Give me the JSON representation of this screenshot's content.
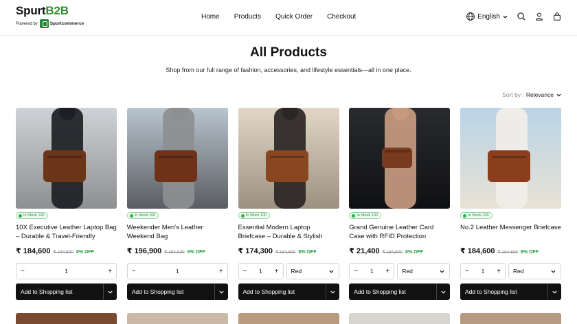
{
  "header": {
    "logo_main": "Spurt",
    "logo_accent": "B2B",
    "powered_by": "Powered by",
    "powered_brand": "Spurtcommerce",
    "nav": [
      "Home",
      "Products",
      "Quick Order",
      "Checkout"
    ],
    "language": "English"
  },
  "page": {
    "title": "All Products",
    "subtitle": "Shop from our full range of fashion, accessories, and lifestyle essentials—all in one place.",
    "sort_label": "Sort by :",
    "sort_value": "Relevance"
  },
  "add_label": "Add to Shopping list",
  "products": [
    {
      "stock": "In Stock 100",
      "name": "10X Executive Leather Laptop Bag – Durable & Travel-Friendly",
      "price": "₹ 184,600",
      "was": "₹ 194,500",
      "off": "8% OFF",
      "qty": "1",
      "variant": "",
      "palette": {
        "bg1": "#cfd2d6",
        "bg2": "#8e8f91",
        "bag": "#6b3519",
        "figure": "#1d1f24"
      }
    },
    {
      "stock": "In Stock 100",
      "name": "Weekender Men's Leather Weekend Bag",
      "price": "₹ 196,900",
      "was": "₹ 184,630",
      "off": "8% OFF",
      "qty": "1",
      "variant": "",
      "palette": {
        "bg1": "#b8c4cf",
        "bg2": "#5a5d62",
        "bag": "#6e3218",
        "figure": "#8d8f91"
      }
    },
    {
      "stock": "In Stock 100",
      "name": "Essential Modern Laptop Briefcase – Durable & Stylish",
      "price": "₹ 174,300",
      "was": "₹ 184,600",
      "off": "8% OFF",
      "qty": "1",
      "variant": "Red",
      "palette": {
        "bg1": "#e2d7c7",
        "bg2": "#9c9080",
        "bag": "#8a4620",
        "figure": "#2a2624"
      }
    },
    {
      "stock": "In Stock 100",
      "name": "Grand Genuine Leather Card Case with RFID Protection",
      "price": "₹ 21,400",
      "was": "₹ 184,600",
      "off": "8% OFF",
      "qty": "1",
      "variant": "Red",
      "palette": {
        "bg1": "#2a2b2e",
        "bg2": "#0f1012",
        "bag": "#7a3a1e",
        "figure": "#c79a80"
      }
    },
    {
      "stock": "In Stock 100",
      "name": "No.2 Leather Messenger Briefcase",
      "price": "₹ 184,600",
      "was": "₹ 184,600",
      "off": "8% OFF",
      "qty": "1",
      "variant": "Red",
      "palette": {
        "bg1": "#b9d3e6",
        "bg2": "#e8e2d6",
        "bag": "#8b3e1e",
        "figure": "#f1eee8"
      }
    }
  ]
}
